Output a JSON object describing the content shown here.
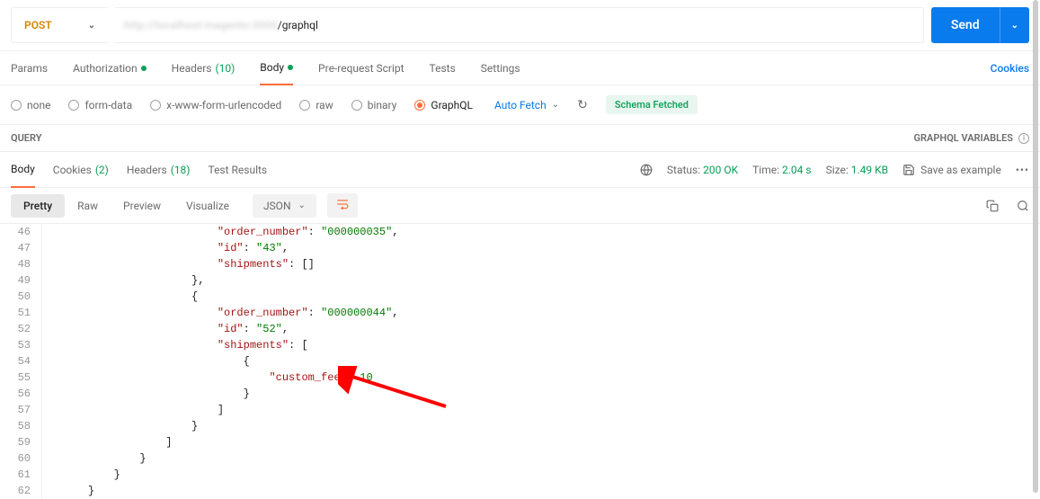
{
  "request": {
    "method": "POST",
    "url_hidden_prefix": "http://localhost:magento:3000",
    "url_visible": "/graphql",
    "send_label": "Send"
  },
  "request_tabs": {
    "params": "Params",
    "authorization": "Authorization",
    "headers": "Headers",
    "headers_count": "(10)",
    "body": "Body",
    "prerequest": "Pre-request Script",
    "tests": "Tests",
    "settings": "Settings",
    "cookies_link": "Cookies"
  },
  "body_types": {
    "none": "none",
    "form_data": "form-data",
    "urlencoded": "x-www-form-urlencoded",
    "raw": "raw",
    "binary": "binary",
    "graphql": "GraphQL",
    "auto_fetch": "Auto Fetch",
    "schema_status": "Schema Fetched"
  },
  "sections": {
    "query": "QUERY",
    "variables": "GRAPHQL VARIABLES"
  },
  "response_tabs": {
    "body": "Body",
    "cookies": "Cookies",
    "cookies_count": "(2)",
    "headers": "Headers",
    "headers_count": "(18)",
    "test_results": "Test Results"
  },
  "response_meta": {
    "status_label": "Status:",
    "status_value": "200 OK",
    "time_label": "Time:",
    "time_value": "2.04 s",
    "size_label": "Size:",
    "size_value": "1.49 KB",
    "save_example": "Save as example"
  },
  "viewer": {
    "pretty": "Pretty",
    "raw": "Raw",
    "preview": "Preview",
    "visualize": "Visualize",
    "format": "JSON"
  },
  "json_body": {
    "order1": {
      "order_number_key": "\"order_number\"",
      "order_number_val": "\"000000035\"",
      "id_key": "\"id\"",
      "id_val": "\"43\"",
      "shipments_key": "\"shipments\""
    },
    "order2": {
      "order_number_key": "\"order_number\"",
      "order_number_val": "\"000000044\"",
      "id_key": "\"id\"",
      "id_val": "\"52\"",
      "shipments_key": "\"shipments\"",
      "custom_fee_key": "\"custom_fee\"",
      "custom_fee_val": "10"
    }
  },
  "line_numbers": [
    "46",
    "47",
    "48",
    "49",
    "50",
    "51",
    "52",
    "53",
    "54",
    "55",
    "56",
    "57",
    "58",
    "59",
    "60",
    "61",
    "62"
  ]
}
